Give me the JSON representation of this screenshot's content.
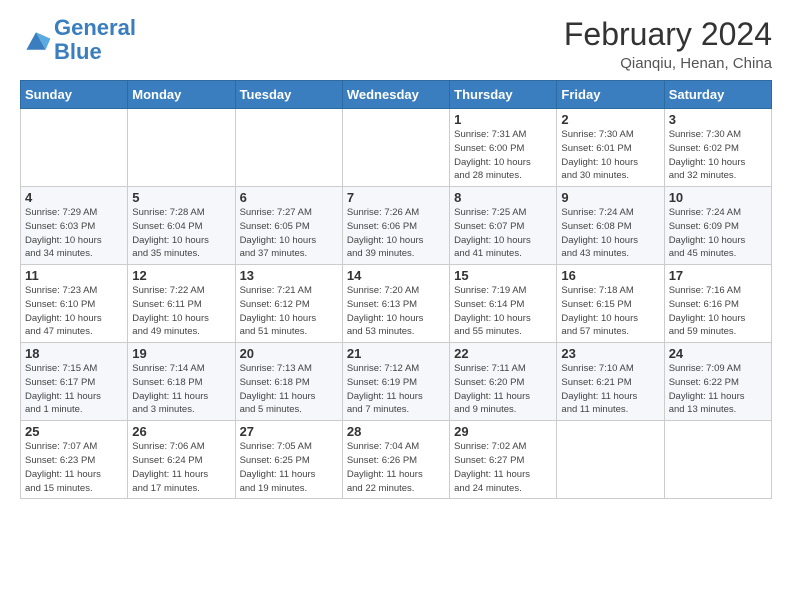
{
  "header": {
    "logo_line1": "General",
    "logo_line2": "Blue",
    "title": "February 2024",
    "subtitle": "Qianqiu, Henan, China"
  },
  "days_of_week": [
    "Sunday",
    "Monday",
    "Tuesday",
    "Wednesday",
    "Thursday",
    "Friday",
    "Saturday"
  ],
  "weeks": [
    [
      {
        "day": "",
        "info": ""
      },
      {
        "day": "",
        "info": ""
      },
      {
        "day": "",
        "info": ""
      },
      {
        "day": "",
        "info": ""
      },
      {
        "day": "1",
        "info": "Sunrise: 7:31 AM\nSunset: 6:00 PM\nDaylight: 10 hours\nand 28 minutes."
      },
      {
        "day": "2",
        "info": "Sunrise: 7:30 AM\nSunset: 6:01 PM\nDaylight: 10 hours\nand 30 minutes."
      },
      {
        "day": "3",
        "info": "Sunrise: 7:30 AM\nSunset: 6:02 PM\nDaylight: 10 hours\nand 32 minutes."
      }
    ],
    [
      {
        "day": "4",
        "info": "Sunrise: 7:29 AM\nSunset: 6:03 PM\nDaylight: 10 hours\nand 34 minutes."
      },
      {
        "day": "5",
        "info": "Sunrise: 7:28 AM\nSunset: 6:04 PM\nDaylight: 10 hours\nand 35 minutes."
      },
      {
        "day": "6",
        "info": "Sunrise: 7:27 AM\nSunset: 6:05 PM\nDaylight: 10 hours\nand 37 minutes."
      },
      {
        "day": "7",
        "info": "Sunrise: 7:26 AM\nSunset: 6:06 PM\nDaylight: 10 hours\nand 39 minutes."
      },
      {
        "day": "8",
        "info": "Sunrise: 7:25 AM\nSunset: 6:07 PM\nDaylight: 10 hours\nand 41 minutes."
      },
      {
        "day": "9",
        "info": "Sunrise: 7:24 AM\nSunset: 6:08 PM\nDaylight: 10 hours\nand 43 minutes."
      },
      {
        "day": "10",
        "info": "Sunrise: 7:24 AM\nSunset: 6:09 PM\nDaylight: 10 hours\nand 45 minutes."
      }
    ],
    [
      {
        "day": "11",
        "info": "Sunrise: 7:23 AM\nSunset: 6:10 PM\nDaylight: 10 hours\nand 47 minutes."
      },
      {
        "day": "12",
        "info": "Sunrise: 7:22 AM\nSunset: 6:11 PM\nDaylight: 10 hours\nand 49 minutes."
      },
      {
        "day": "13",
        "info": "Sunrise: 7:21 AM\nSunset: 6:12 PM\nDaylight: 10 hours\nand 51 minutes."
      },
      {
        "day": "14",
        "info": "Sunrise: 7:20 AM\nSunset: 6:13 PM\nDaylight: 10 hours\nand 53 minutes."
      },
      {
        "day": "15",
        "info": "Sunrise: 7:19 AM\nSunset: 6:14 PM\nDaylight: 10 hours\nand 55 minutes."
      },
      {
        "day": "16",
        "info": "Sunrise: 7:18 AM\nSunset: 6:15 PM\nDaylight: 10 hours\nand 57 minutes."
      },
      {
        "day": "17",
        "info": "Sunrise: 7:16 AM\nSunset: 6:16 PM\nDaylight: 10 hours\nand 59 minutes."
      }
    ],
    [
      {
        "day": "18",
        "info": "Sunrise: 7:15 AM\nSunset: 6:17 PM\nDaylight: 11 hours\nand 1 minute."
      },
      {
        "day": "19",
        "info": "Sunrise: 7:14 AM\nSunset: 6:18 PM\nDaylight: 11 hours\nand 3 minutes."
      },
      {
        "day": "20",
        "info": "Sunrise: 7:13 AM\nSunset: 6:18 PM\nDaylight: 11 hours\nand 5 minutes."
      },
      {
        "day": "21",
        "info": "Sunrise: 7:12 AM\nSunset: 6:19 PM\nDaylight: 11 hours\nand 7 minutes."
      },
      {
        "day": "22",
        "info": "Sunrise: 7:11 AM\nSunset: 6:20 PM\nDaylight: 11 hours\nand 9 minutes."
      },
      {
        "day": "23",
        "info": "Sunrise: 7:10 AM\nSunset: 6:21 PM\nDaylight: 11 hours\nand 11 minutes."
      },
      {
        "day": "24",
        "info": "Sunrise: 7:09 AM\nSunset: 6:22 PM\nDaylight: 11 hours\nand 13 minutes."
      }
    ],
    [
      {
        "day": "25",
        "info": "Sunrise: 7:07 AM\nSunset: 6:23 PM\nDaylight: 11 hours\nand 15 minutes."
      },
      {
        "day": "26",
        "info": "Sunrise: 7:06 AM\nSunset: 6:24 PM\nDaylight: 11 hours\nand 17 minutes."
      },
      {
        "day": "27",
        "info": "Sunrise: 7:05 AM\nSunset: 6:25 PM\nDaylight: 11 hours\nand 19 minutes."
      },
      {
        "day": "28",
        "info": "Sunrise: 7:04 AM\nSunset: 6:26 PM\nDaylight: 11 hours\nand 22 minutes."
      },
      {
        "day": "29",
        "info": "Sunrise: 7:02 AM\nSunset: 6:27 PM\nDaylight: 11 hours\nand 24 minutes."
      },
      {
        "day": "",
        "info": ""
      },
      {
        "day": "",
        "info": ""
      }
    ]
  ]
}
